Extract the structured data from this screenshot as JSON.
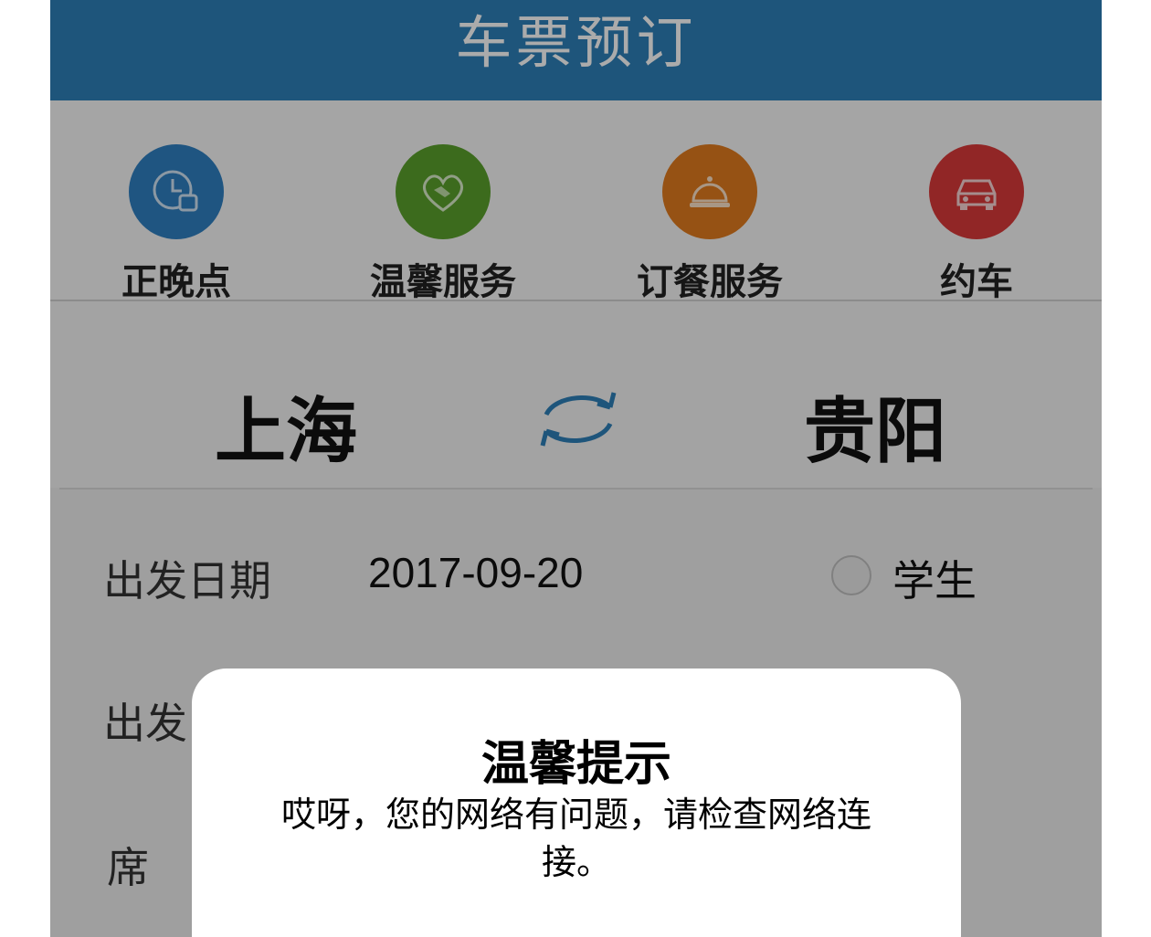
{
  "header": {
    "title": "车票预订"
  },
  "services": [
    {
      "label": "正晚点",
      "icon": "clock-icon",
      "color": "#2f7fc1"
    },
    {
      "label": "温馨服务",
      "icon": "heart-handshake-icon",
      "color": "#5aa02c"
    },
    {
      "label": "订餐服务",
      "icon": "food-cloche-icon",
      "color": "#e07b1f"
    },
    {
      "label": "约车",
      "icon": "car-icon",
      "color": "#d93a3a"
    }
  ],
  "route": {
    "from": "上海",
    "to": "贵阳",
    "swap_icon": "swap-arrows-icon"
  },
  "form": {
    "date_label": "出发日期",
    "date_value": "2017-09-20",
    "student_label": "学生",
    "time_label_partial": "出发",
    "seat_label_partial": "席"
  },
  "dialog": {
    "title": "温馨提示",
    "message": "哎呀，您的网络有问题，请检查网络连接。"
  },
  "colors": {
    "header": "#2e7fb8",
    "swap": "#2e7fb8"
  }
}
